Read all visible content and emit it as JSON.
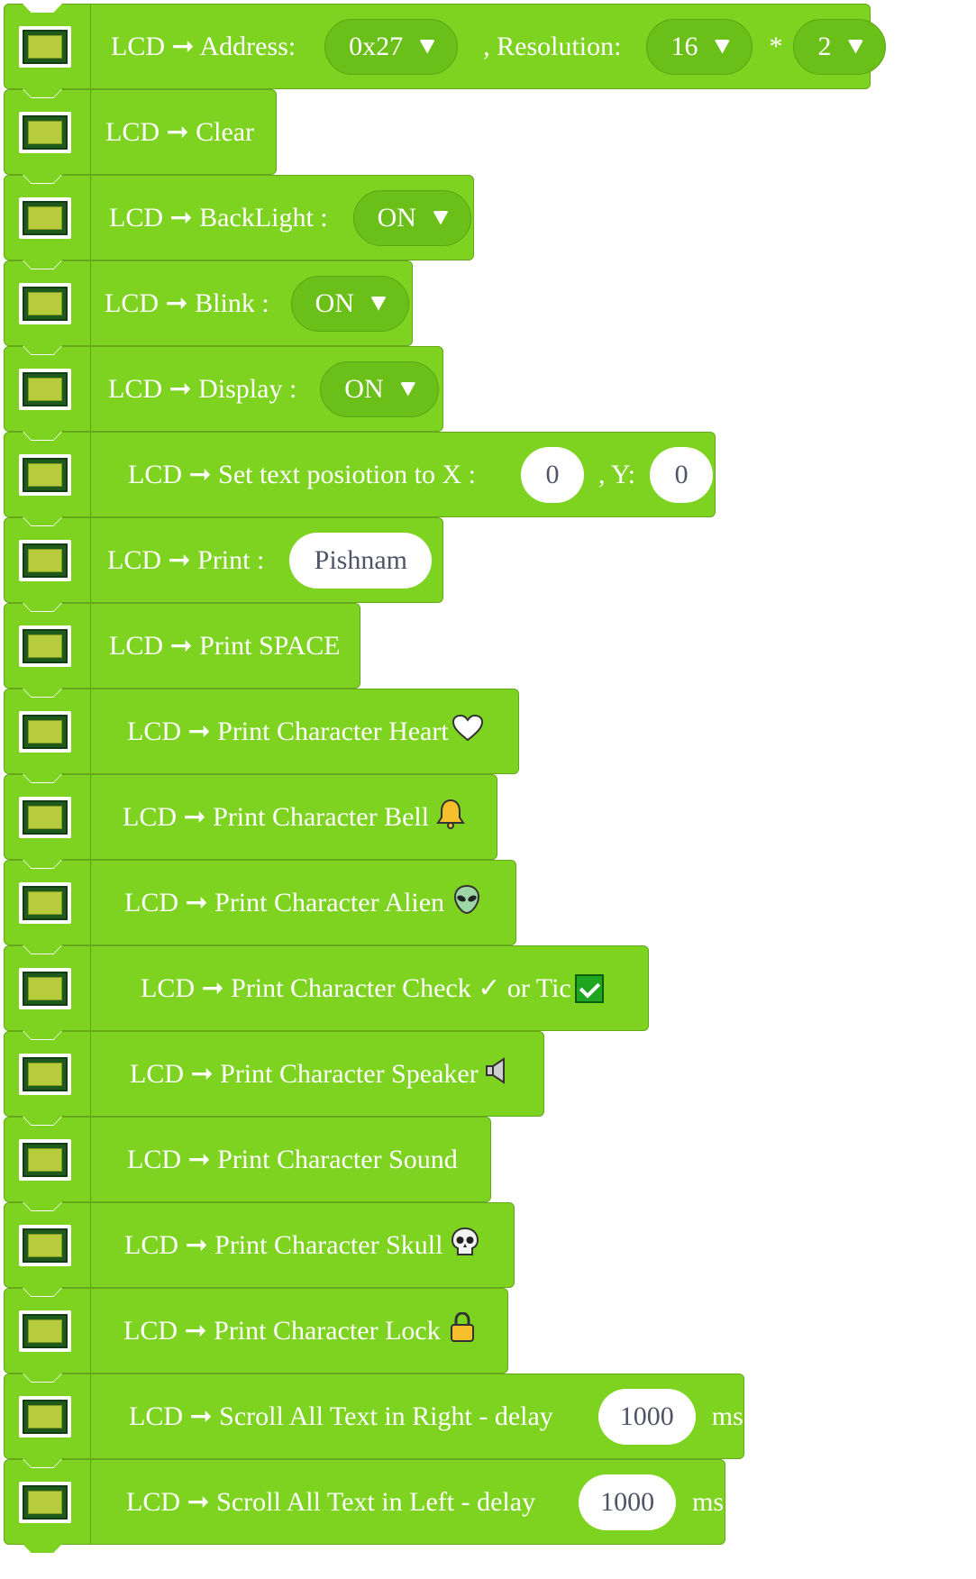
{
  "colors": {
    "block": "#7ed321",
    "dropdown": "#6bbf19",
    "text": "#ffffff",
    "field_text": "#4f5466"
  },
  "blocks": {
    "init": {
      "prefix": "LCD ➞ Address:",
      "address": "0x27",
      "resolution_label": ", Resolution:",
      "cols": "16",
      "times": "*",
      "rows": "2"
    },
    "clear": {
      "label": "LCD ➞ Clear"
    },
    "backlight": {
      "label": "LCD ➞ BackLight :",
      "value": "ON"
    },
    "blink": {
      "label": "LCD ➞ Blink :",
      "value": "ON"
    },
    "display": {
      "label": "LCD ➞ Display :",
      "value": "ON"
    },
    "set_pos": {
      "label": "LCD ➞ Set text posiotion to X :",
      "x": "0",
      "y_label": ", Y:",
      "y": "0"
    },
    "print": {
      "label": "LCD ➞ Print :",
      "value": "Pishnam"
    },
    "print_space": {
      "label": "LCD ➞ Print SPACE"
    },
    "heart": {
      "label": "LCD ➞ Print Character Heart",
      "icon": "heart-icon"
    },
    "bell": {
      "label": "LCD ➞ Print Character Bell",
      "icon": "bell-icon"
    },
    "alien": {
      "label": "LCD ➞ Print Character Alien",
      "icon": "alien-icon"
    },
    "check": {
      "label": "LCD ➞ Print Character Check ✓ or Tic",
      "icon": "checkbox-icon"
    },
    "speaker": {
      "label": "LCD ➞ Print Character Speaker",
      "icon": "speaker-icon"
    },
    "sound": {
      "label": "LCD ➞ Print Character Sound"
    },
    "skull": {
      "label": "LCD ➞ Print Character Skull",
      "icon": "skull-icon"
    },
    "lock": {
      "label": "LCD ➞ Print Character Lock",
      "icon": "lock-icon"
    },
    "scroll_right": {
      "label": "LCD ➞ Scroll All Text in Right - delay",
      "value": "1000",
      "unit": "ms"
    },
    "scroll_left": {
      "label": "LCD ➞ Scroll All Text in Left - delay",
      "value": "1000",
      "unit": "ms"
    }
  }
}
